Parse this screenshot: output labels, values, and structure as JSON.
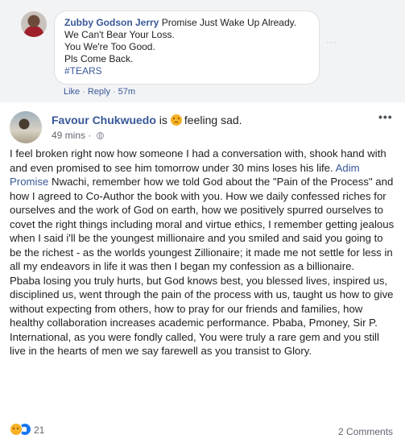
{
  "comment": {
    "author": "Zubby Godson Jerry",
    "lines": [
      "Promise Just Wake Up Already.",
      "We Can't Bear Your Loss.",
      "You We're Too Good.",
      "Pls Come Back.",
      "#TEARS"
    ],
    "more": "···",
    "like_label": "Like",
    "reply_label": "Reply",
    "separator": "·",
    "time": "57m"
  },
  "post": {
    "author": "Favour Chukwuedo",
    "is_text": "is",
    "feeling_emoji": "sad-face-icon",
    "feeling_text": "feeling sad.",
    "time": "49 mins",
    "meta_separator": "·",
    "privacy_icon": "globe-icon",
    "more": "•••",
    "body_before_mention": "I feel broken right now how someone I had a conversation with, shook hand with and even promised to see him tomorrow under 30 mins loses his life.",
    "mention": "Adim Promise",
    "body_after_mention": " Nwachi, remember how we told God about the \"Pain of the Process\" and how I agreed to Co-Author the book with you. How we daily confessed riches for ourselves and the work of God on earth, how we positively spurred ourselves to covet the right things including moral and virtue ethics, I remember getting jealous when I said i'll be the youngest millionaire and you smiled and said you going to be the richest - as the worlds youngest Zillionaire; it made me not settle for less in all my endeavors in life it was then I began my confession as a billionaire.",
    "body_paragraph2": "Pbaba losing you truly hurts, but God knows best, you blessed lives, inspired us, disciplined us, went through the pain of the process with us, taught us how to give without expecting from others, how to pray for our friends and families, how healthy collaboration increases academic performance. Pbaba, Pmoney, Sir P. International, as you were fondly called, You were truly a rare gem and you still live in the hearts of men we say farewell as you transist to Glory.",
    "reaction_count": "21",
    "comments_count": "2 Comments"
  },
  "colors": {
    "link": "#385898",
    "text": "#1c1e21",
    "meta": "#616770",
    "like_blue": "#1877f2",
    "sad_yellow": "#f7b125"
  }
}
